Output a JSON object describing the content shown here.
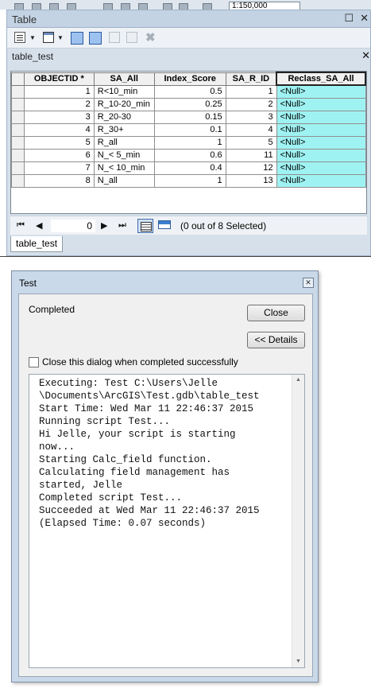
{
  "app_toolbar": {
    "scale_value": "1:150,000"
  },
  "table_window": {
    "title": "Table",
    "title_buttons": {
      "float": "☐",
      "close": "✕"
    },
    "tab_label": "table_test",
    "tab_close": "✕",
    "columns": [
      "OBJECTID *",
      "SA_All",
      "Index_Score",
      "SA_R_ID",
      "Reclass_SA_All"
    ],
    "rows": [
      {
        "objectid": "1",
        "sa_all": "R<10_min",
        "index_score": "0.5",
        "sa_r_id": "1",
        "reclass": "<Null>"
      },
      {
        "objectid": "2",
        "sa_all": "R_10-20_min",
        "index_score": "0.25",
        "sa_r_id": "2",
        "reclass": "<Null>"
      },
      {
        "objectid": "3",
        "sa_all": "R_20-30",
        "index_score": "0.15",
        "sa_r_id": "3",
        "reclass": "<Null>"
      },
      {
        "objectid": "4",
        "sa_all": "R_30+",
        "index_score": "0.1",
        "sa_r_id": "4",
        "reclass": "<Null>"
      },
      {
        "objectid": "5",
        "sa_all": "R_all",
        "index_score": "1",
        "sa_r_id": "5",
        "reclass": "<Null>"
      },
      {
        "objectid": "6",
        "sa_all": "N_< 5_min",
        "index_score": "0.6",
        "sa_r_id": "11",
        "reclass": "<Null>"
      },
      {
        "objectid": "7",
        "sa_all": "N_< 10_min",
        "index_score": "0.4",
        "sa_r_id": "12",
        "reclass": "<Null>"
      },
      {
        "objectid": "8",
        "sa_all": "N_all",
        "index_score": "1",
        "sa_r_id": "13",
        "reclass": "<Null>"
      }
    ],
    "nav": {
      "first": "⏮",
      "prev": "◀",
      "current_record": "0",
      "next": "▶",
      "last": "⏭",
      "selection_status": "(0 out of 8 Selected)"
    },
    "bottom_tab": "table_test"
  },
  "gp_dialog": {
    "title": "Test",
    "close_glyph": "✕",
    "status": "Completed",
    "close_button": "Close",
    "details_button": "<< Details",
    "checkbox_label": "Close this dialog when completed successfully",
    "output_lines": [
      "Executing: Test C:\\Users\\Jelle",
      "\\Documents\\ArcGIS\\Test.gdb\\table_test",
      "Start Time: Wed Mar 11 22:46:37 2015",
      "Running script Test...",
      "Hi Jelle, your script is starting",
      "now...",
      "Starting Calc_field function.",
      "Calculating field management has",
      "started, Jelle",
      "Completed script Test...",
      "Succeeded at Wed Mar 11 22:46:37 2015",
      "(Elapsed Time: 0.07 seconds)"
    ],
    "scroll_up": "▲",
    "scroll_down": "▼"
  },
  "colors": {
    "reclass_highlight": "#9ff2f2",
    "window_frame": "#d6e0eb",
    "dialog_frame": "#c9d9ea"
  }
}
